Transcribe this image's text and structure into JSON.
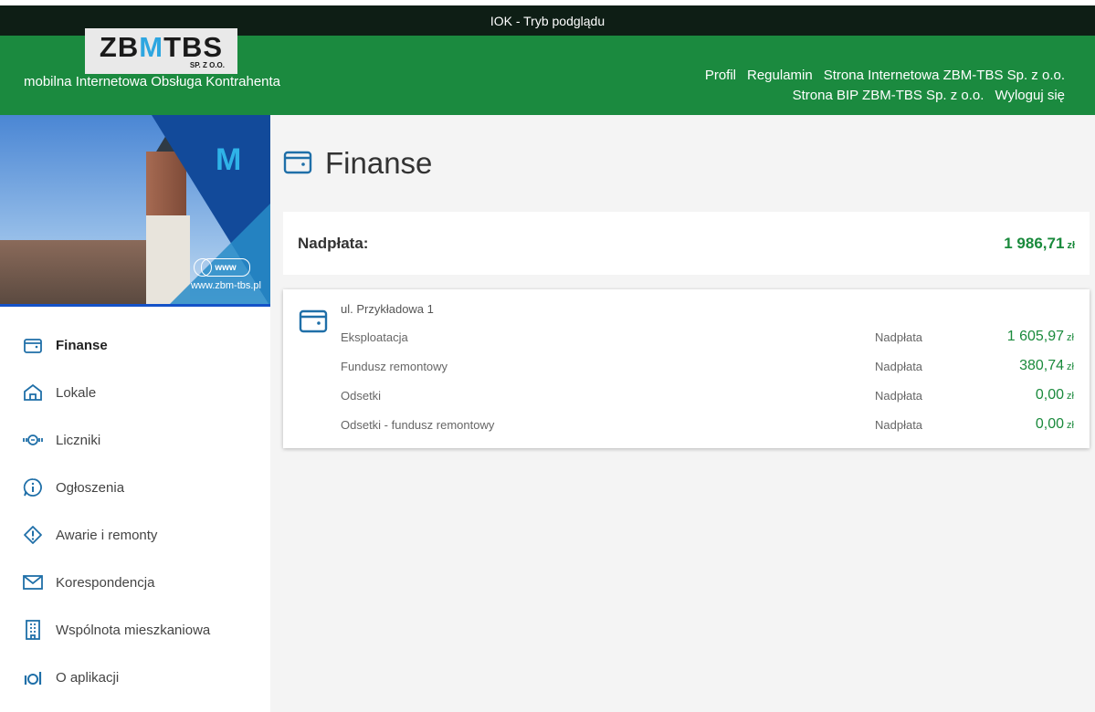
{
  "preview_bar": {
    "title": "IOK - Tryb podglądu"
  },
  "header": {
    "logo_left": "ZB",
    "logo_mid": "M",
    "logo_right": "TBS",
    "logo_sub": "SP. Z O.O.",
    "subtitle": "mobilna Internetowa Obsługa Kontrahenta",
    "nav_row1": [
      "Profil",
      "Regulamin",
      "Strona Internetowa ZBM-TBS Sp. z o.o."
    ],
    "nav_row2": [
      "Strona BIP ZBM-TBS Sp. z o.o.",
      "Wyloguj się"
    ]
  },
  "hero": {
    "www": "www",
    "url": "www.zbm-tbs.pl"
  },
  "sidebar": {
    "items": [
      {
        "label": "Finanse",
        "icon": "wallet-icon",
        "active": true
      },
      {
        "label": "Lokale",
        "icon": "home-icon"
      },
      {
        "label": "Liczniki",
        "icon": "meter-icon"
      },
      {
        "label": "Ogłoszenia",
        "icon": "info-bubble-icon"
      },
      {
        "label": "Awarie i remonty",
        "icon": "alert-icon"
      },
      {
        "label": "Korespondencja",
        "icon": "envelope-icon"
      },
      {
        "label": "Wspólnota mieszkaniowa",
        "icon": "building-icon"
      },
      {
        "label": "O aplikacji",
        "icon": "app-info-icon"
      }
    ]
  },
  "main": {
    "title": "Finanse",
    "summary": {
      "label": "Nadpłata:",
      "amount": "1 986,71",
      "currency": "zł"
    },
    "card": {
      "address": "ul. Przykładowa 1",
      "rows": [
        {
          "name": "Eksploatacja",
          "status": "Nadpłata",
          "value": "1 605,97",
          "currency": "zł"
        },
        {
          "name": "Fundusz remontowy",
          "status": "Nadpłata",
          "value": "380,74",
          "currency": "zł"
        },
        {
          "name": "Odsetki",
          "status": "Nadpłata",
          "value": "0,00",
          "currency": "zł"
        },
        {
          "name": "Odsetki - fundusz remontowy",
          "status": "Nadpłata",
          "value": "0,00",
          "currency": "zł"
        }
      ]
    }
  },
  "colors": {
    "header_green": "#1b8a3f",
    "amount_green": "#1a8a3c",
    "icon_blue": "#1f6fa8"
  }
}
